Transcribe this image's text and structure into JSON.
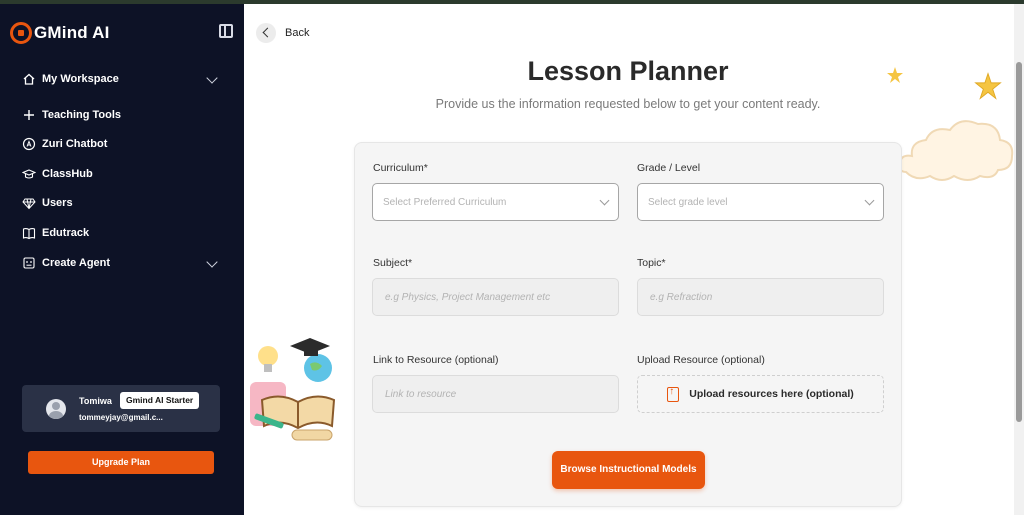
{
  "app": {
    "brand_name": "GMind AI",
    "accent_color": "#e8560f",
    "sidebar_bg": "#0d1226"
  },
  "sidebar": {
    "items": [
      {
        "label": "My Workspace",
        "icon": "home-icon",
        "has_chevron": true
      },
      {
        "label": "Teaching Tools",
        "icon": "plus-icon",
        "has_chevron": false
      },
      {
        "label": "Zuri Chatbot",
        "icon": "chatbot-icon",
        "has_chevron": false
      },
      {
        "label": "ClassHub",
        "icon": "graduation-cap-icon",
        "has_chevron": false
      },
      {
        "label": "Users",
        "icon": "diamond-icon",
        "has_chevron": false
      },
      {
        "label": "Edutrack",
        "icon": "book-icon",
        "has_chevron": false
      },
      {
        "label": "Create Agent",
        "icon": "agent-icon",
        "has_chevron": true
      }
    ],
    "user": {
      "name": "Tomiwa",
      "plan": "Gmind AI Starter",
      "email": "tommeyjay@gmail.c..."
    },
    "upgrade_label": "Upgrade Plan"
  },
  "header": {
    "back_label": "Back"
  },
  "page": {
    "title": "Lesson Planner",
    "subtitle": "Provide us the information requested below to get your content ready."
  },
  "form": {
    "curriculum": {
      "label": "Curriculum*",
      "placeholder": "Select Preferred Curriculum"
    },
    "grade": {
      "label": "Grade / Level",
      "placeholder": "Select grade level"
    },
    "subject": {
      "label": "Subject*",
      "placeholder": "e.g Physics, Project Management etc"
    },
    "topic": {
      "label": "Topic*",
      "placeholder": "e.g Refraction"
    },
    "link": {
      "label": "Link to Resource (optional)",
      "placeholder": "Link to resource"
    },
    "upload": {
      "label": "Upload Resource (optional)",
      "button": "Upload resources here (optional)"
    },
    "submit_label": "Browse Instructional Models"
  }
}
